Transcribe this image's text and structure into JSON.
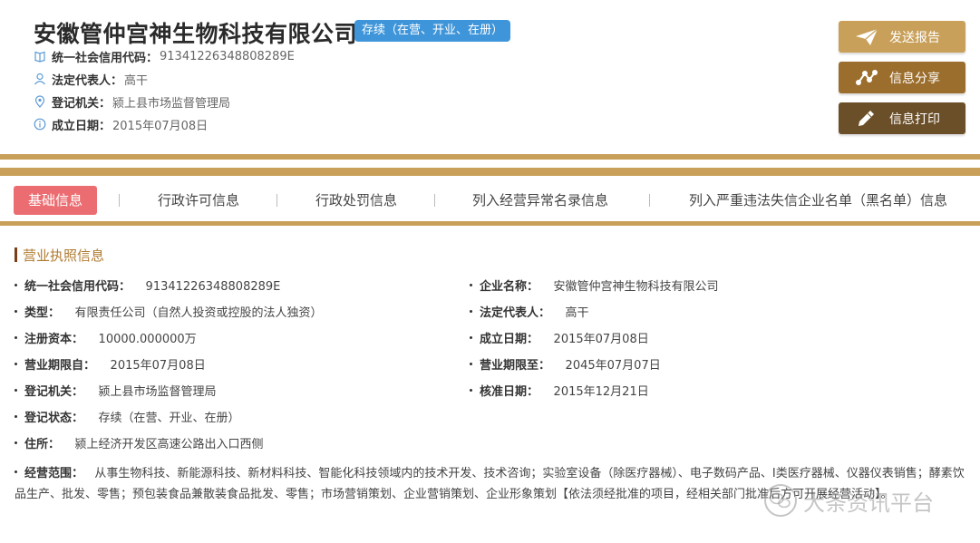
{
  "header": {
    "company_name": "安徽管仲宫神生物科技有限公司",
    "status_badge": "存续（在营、开业、在册）",
    "meta": [
      {
        "icon": "book-icon",
        "label": "统一社会信用代码：",
        "value": "91341226348808289E"
      },
      {
        "icon": "person-icon",
        "label": "法定代表人：",
        "value": "高干"
      },
      {
        "icon": "location-pin-icon",
        "label": "登记机关：",
        "value": "颍上县市场监督管理局"
      },
      {
        "icon": "info-circle-icon",
        "label": "成立日期：",
        "value": "2015年07月08日"
      }
    ],
    "actions": [
      {
        "label": "发送报告",
        "icon": "send-plane-icon",
        "color": "#c9a05a"
      },
      {
        "label": "信息分享",
        "icon": "share-nodes-icon",
        "color": "#9b6e2d"
      },
      {
        "label": "信息打印",
        "icon": "pencil-icon",
        "color": "#6b4f28"
      }
    ]
  },
  "tabs": [
    {
      "label": "基础信息",
      "active": true
    },
    {
      "label": "行政许可信息",
      "active": false
    },
    {
      "label": "行政处罚信息",
      "active": false
    },
    {
      "label": "列入经营异常名录信息",
      "active": false
    },
    {
      "label": "列入严重违法失信企业名单（黑名单）信息",
      "active": false
    }
  ],
  "section": {
    "title": "营业执照信息",
    "fields": [
      {
        "label": "统一社会信用代码：",
        "value": "91341226348808289E"
      },
      {
        "label": "企业名称：",
        "value": "安徽管仲宫神生物科技有限公司"
      },
      {
        "label": "类型：",
        "value": "有限责任公司（自然人投资或控股的法人独资）"
      },
      {
        "label": "法定代表人：",
        "value": "高干"
      },
      {
        "label": "注册资本：",
        "value": "10000.000000万"
      },
      {
        "label": "成立日期：",
        "value": "2015年07月08日"
      },
      {
        "label": "营业期限自：",
        "value": "2015年07月08日"
      },
      {
        "label": "营业期限至：",
        "value": "2045年07月07日"
      },
      {
        "label": "登记机关：",
        "value": "颍上县市场监督管理局"
      },
      {
        "label": "核准日期：",
        "value": "2015年12月21日"
      },
      {
        "label": "登记状态：",
        "value": "存续（在营、开业、在册）"
      },
      {
        "label": "住所：",
        "value": "颍上经济开发区高速公路出入口西侧"
      }
    ],
    "scope_label": "经营范围：",
    "scope_value": "从事生物科技、新能源科技、新材料科技、智能化科技领域内的技术开发、技术咨询；实验室设备（除医疗器械）、电子数码产品、I类医疗器械、仪器仪表销售；酵素饮品生产、批发、零售；预包装食品兼散装食品批发、零售；市场营销策划、企业营销策划、企业形象策划【依法须经批准的项目，经相关部门批准后方可开展经营活动】。"
  },
  "watermark": "大条资讯平台",
  "colors": {
    "accent_gold": "#c9a05a",
    "badge_blue": "#3f95d9",
    "active_tab": "#ec6d71",
    "section_title": "#b07a2f"
  }
}
